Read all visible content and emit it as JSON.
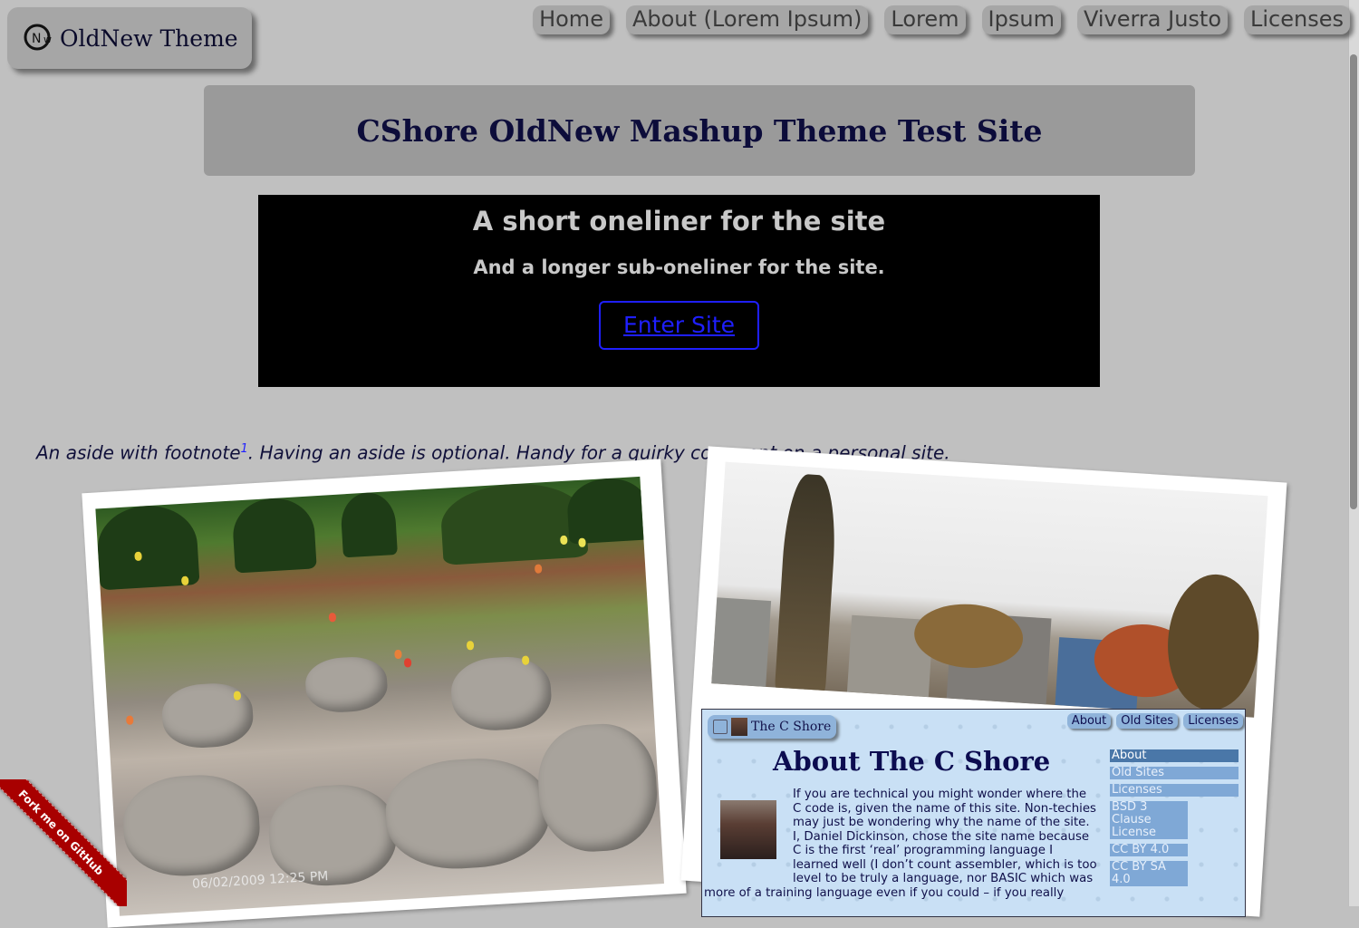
{
  "logo": {
    "title": "OldNew Theme",
    "icon": "oldnew-logo-icon"
  },
  "topnav": {
    "items": [
      "Home",
      "About (Lorem Ipsum)",
      "Lorem",
      "Ipsum",
      "Viverra Justo",
      "Licenses"
    ]
  },
  "site_title": "CShore OldNew Mashup Theme Test Site",
  "hero": {
    "title": "A short oneliner for the site",
    "subtitle": "And a longer sub-oneliner for the site.",
    "button": "Enter Site"
  },
  "aside": {
    "before": "An aside with footnote",
    "footnote": "1",
    "after": ". Having an aside is optional. Handy for a quirky comment on a personal site."
  },
  "photos": {
    "left_stamp": "06/02/2009 12:25 PM"
  },
  "embed": {
    "logo_label": "The C Shore",
    "nav": [
      "About",
      "Old Sites",
      "Licenses"
    ],
    "heading": "About The C Shore",
    "paragraph_lines": [
      "If you are technical you might wonder where the",
      "C code is, given the name of this site. Non-techies",
      "may just be wondering why the name of the site.",
      "I, Daniel Dickinson, chose the site name because",
      "C is the first ‘real’ programming language I",
      "learned well (I don’t count assembler, which is too",
      "level to be truly a language, nor BASIC which was"
    ],
    "paragraph_tail": "more of a training language even if you could – if you really",
    "sidebar": [
      "About",
      "Old Sites",
      "Licenses"
    ],
    "sidebar_sub": [
      "BSD 3 Clause License",
      "CC BY 4.0",
      "CC BY SA 4.0"
    ]
  },
  "ribbon": "Fork me on GitHub"
}
